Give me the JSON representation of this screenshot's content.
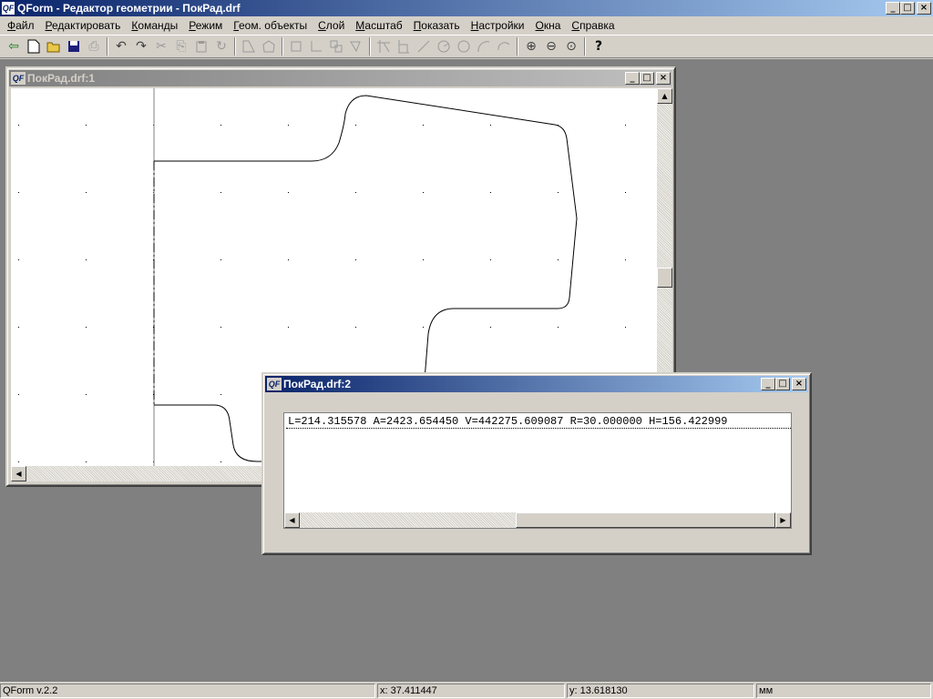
{
  "app": {
    "icon_text": "QF",
    "title": "QForm - Редактор геометрии  - ПокРад.drf",
    "min_label": "_",
    "max_label": "□",
    "close_label": "×"
  },
  "menu": [
    "Файл",
    "Редактировать",
    "Команды",
    "Режим",
    "Геом. объекты",
    "Слой",
    "Масштаб",
    "Показать",
    "Настройки",
    "Окна",
    "Справка"
  ],
  "toolbar": {
    "icons": {
      "exit": "⇦",
      "new": "🗋",
      "open": "📂",
      "save": "💾",
      "print": "⎙",
      "undo": "↶",
      "redo": "↷",
      "cut": "✂",
      "copy": "⎘",
      "paste": "📋",
      "refresh": "↻",
      "zoom_in": "⊕",
      "zoom_out": "⊖",
      "zoom_fit": "⊙",
      "help": "?"
    }
  },
  "window1": {
    "title": "ПокРад.drf:1",
    "icon_text": "QF"
  },
  "window2": {
    "title": "ПокРад.drf:2",
    "icon_text": "QF",
    "result": "L=214.315578 A=2423.654450 V=442275.609087 R=30.000000 H=156.422999"
  },
  "status": {
    "version": "QForm v.2.2",
    "x": "x: 37.411447",
    "y": "y: 13.618130",
    "units": "мм"
  },
  "colors": {
    "active_title": "#0a246a",
    "face": "#d4d0c8",
    "mdi_background": "#808080"
  }
}
